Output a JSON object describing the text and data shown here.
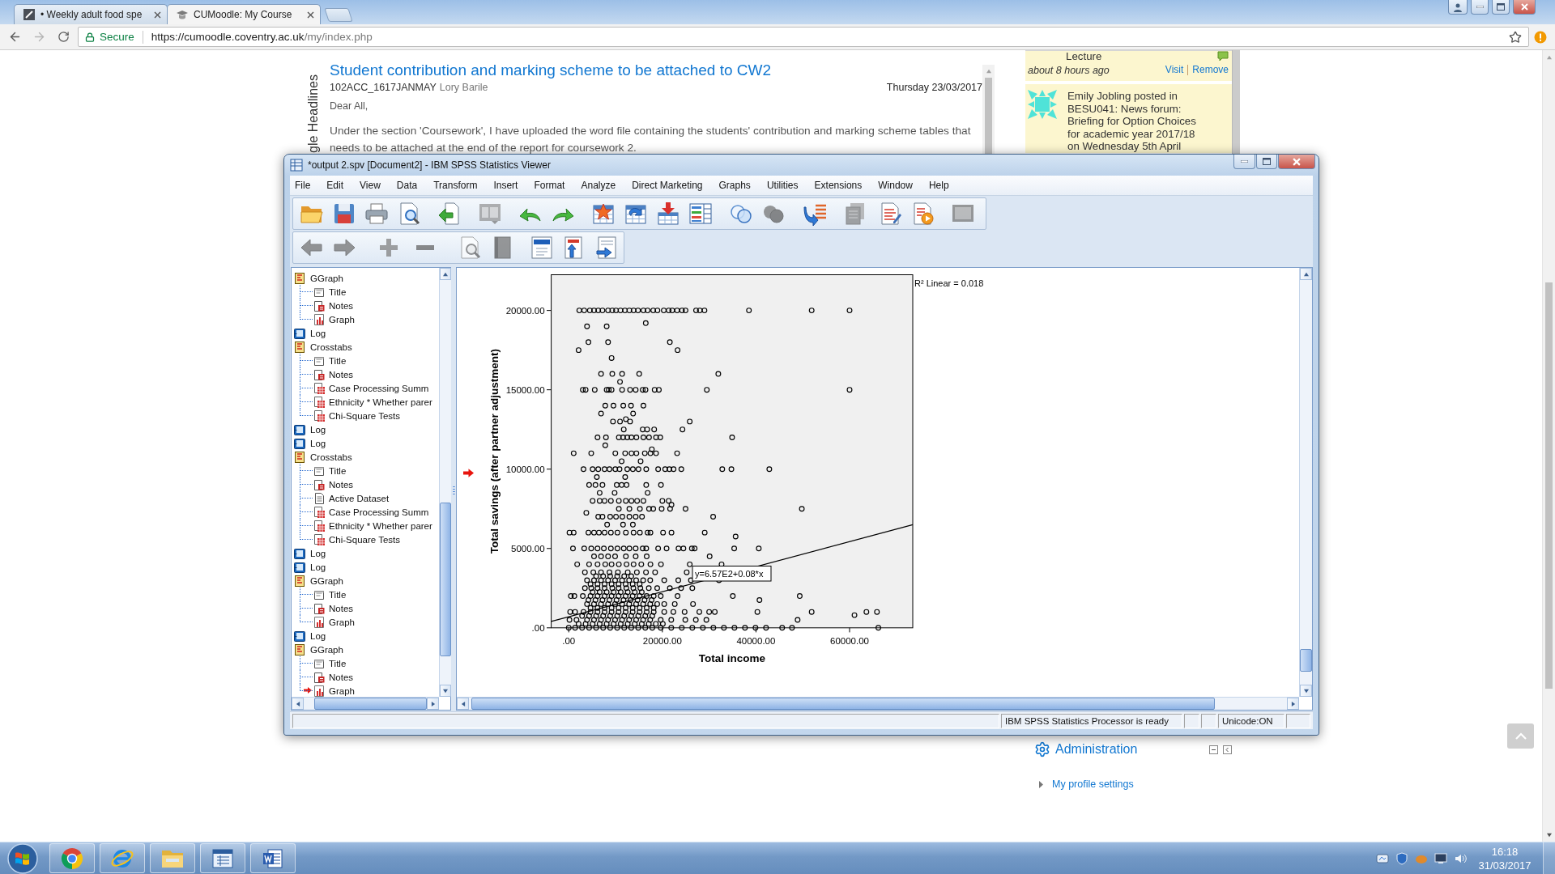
{
  "browser": {
    "tabs": [
      {
        "title": "• Weekly adult food spe",
        "selected": false
      },
      {
        "title": "CUMoodle: My Course",
        "selected": true
      }
    ],
    "back": {
      "disabled": false
    },
    "forward": {
      "disabled": true
    },
    "address": {
      "security": "Secure",
      "url_host": "https://cumoodle.coventry.ac.uk",
      "url_path": "/my/index.php"
    }
  },
  "page": {
    "block_label": "gle Headlines",
    "news": {
      "title": "Student contribution and marking scheme to be attached to CW2",
      "course": "102ACC_1617JANMAY",
      "author": "Lory Barile",
      "date": "Thursday 23/03/2017",
      "greeting": "Dear All,",
      "body": "Under the section 'Coursework', I have uploaded the word file containing the students' contribution and marking scheme tables that needs to be attached at the end of the report for coursework 2."
    },
    "activity": [
      {
        "kind": "update",
        "text": "Lecture",
        "time": "about 8 hours ago",
        "links": [
          "Visit",
          "Remove"
        ]
      },
      {
        "kind": "post",
        "text": "Emily Jobling posted in BESU041: News forum: Briefing for Option Choices for academic year 2017/18 on Wednesday 5th April"
      }
    ],
    "administration": {
      "title": "Administration",
      "items": [
        {
          "label": "My profile settings",
          "expanded": false
        }
      ]
    }
  },
  "spss": {
    "title": "*output 2.spv [Document2] - IBM SPSS Statistics Viewer",
    "menu": [
      "File",
      "Edit",
      "View",
      "Data",
      "Transform",
      "Insert",
      "Format",
      "Analyze",
      "Direct Marketing",
      "Graphs",
      "Utilities",
      "Extensions",
      "Window",
      "Help"
    ],
    "toolbar_1": [
      {
        "kind": "folder",
        "disabled": false
      },
      {
        "kind": "floppy",
        "disabled": false
      },
      {
        "kind": "printer",
        "disabled": false
      },
      {
        "kind": "doc-magnifier",
        "disabled": false
      },
      {
        "kind": "doc-arrow",
        "disabled": false
      },
      {
        "kind": "dialog",
        "disabled": true
      },
      {
        "kind": "undo",
        "disabled": false
      },
      {
        "kind": "redo",
        "disabled": false
      },
      {
        "kind": "table-star",
        "disabled": false
      },
      {
        "kind": "table-arrow",
        "disabled": false
      },
      {
        "kind": "table-down",
        "disabled": false
      },
      {
        "kind": "table-list",
        "disabled": false
      },
      {
        "kind": "circles-outline",
        "disabled": false
      },
      {
        "kind": "circles-filled",
        "disabled": true
      },
      {
        "kind": "arrow-list",
        "disabled": false
      },
      {
        "kind": "stack",
        "disabled": true
      },
      {
        "kind": "doc-lines",
        "disabled": false
      },
      {
        "kind": "doc-play",
        "disabled": false
      },
      {
        "kind": "monitor",
        "disabled": true
      }
    ],
    "toolbar_2": [
      {
        "kind": "arrow-left",
        "disabled": true
      },
      {
        "kind": "arrow-right",
        "disabled": true
      },
      {
        "kind": "plus",
        "disabled": true
      },
      {
        "kind": "minus",
        "disabled": true
      },
      {
        "kind": "doc-magnifier",
        "disabled": true
      },
      {
        "kind": "book",
        "disabled": true
      },
      {
        "kind": "doc-header",
        "disabled": false
      },
      {
        "kind": "doc-title",
        "disabled": false
      },
      {
        "kind": "doc-insert",
        "disabled": false
      }
    ],
    "outline": [
      {
        "label": "GGraph",
        "kind": "procedure",
        "current": false,
        "children": [
          {
            "label": "Title",
            "kind": "title",
            "current": false
          },
          {
            "label": "Notes",
            "kind": "notes",
            "current": false
          },
          {
            "label": "Graph",
            "kind": "chart",
            "current": false
          }
        ]
      },
      {
        "label": "Log",
        "kind": "log",
        "current": false
      },
      {
        "label": "Crosstabs",
        "kind": "procedure",
        "current": false,
        "children": [
          {
            "label": "Title",
            "kind": "title",
            "current": false
          },
          {
            "label": "Notes",
            "kind": "notes",
            "current": false
          },
          {
            "label": "Case Processing Summ",
            "kind": "table",
            "current": false
          },
          {
            "label": "Ethnicity * Whether parer",
            "kind": "table",
            "current": false
          },
          {
            "label": "Chi-Square Tests",
            "kind": "table",
            "current": false
          }
        ]
      },
      {
        "label": "Log",
        "kind": "log",
        "current": false
      },
      {
        "label": "Log",
        "kind": "log",
        "current": false
      },
      {
        "label": "Crosstabs",
        "kind": "procedure",
        "current": false,
        "children": [
          {
            "label": "Title",
            "kind": "title",
            "current": false
          },
          {
            "label": "Notes",
            "kind": "notes",
            "current": false
          },
          {
            "label": "Active Dataset",
            "kind": "text",
            "current": false
          },
          {
            "label": "Case Processing Summ",
            "kind": "table",
            "current": false
          },
          {
            "label": "Ethnicity * Whether parer",
            "kind": "table",
            "current": false
          },
          {
            "label": "Chi-Square Tests",
            "kind": "table",
            "current": false
          }
        ]
      },
      {
        "label": "Log",
        "kind": "log",
        "current": false
      },
      {
        "label": "Log",
        "kind": "log",
        "current": false
      },
      {
        "label": "GGraph",
        "kind": "procedure",
        "current": false,
        "children": [
          {
            "label": "Title",
            "kind": "title",
            "current": false
          },
          {
            "label": "Notes",
            "kind": "notes",
            "current": false
          },
          {
            "label": "Graph",
            "kind": "chart",
            "current": false
          }
        ]
      },
      {
        "label": "Log",
        "kind": "log",
        "current": false
      },
      {
        "label": "GGraph",
        "kind": "procedure",
        "current": false,
        "children": [
          {
            "label": "Title",
            "kind": "title",
            "current": false
          },
          {
            "label": "Notes",
            "kind": "notes",
            "current": false
          },
          {
            "label": "Graph",
            "kind": "chart",
            "current": true
          }
        ]
      }
    ],
    "viewer": {
      "current": true,
      "chart_data": {
        "type": "scatter",
        "xlabel": "Total income",
        "ylabel": "Total savings (after partner adjustment)",
        "xlim": [
          -3750,
          73500
        ],
        "ylim": [
          0,
          22250
        ],
        "xticks": [
          {
            "value": 0,
            "label": ".00"
          },
          {
            "value": 20000,
            "label": "20000.00"
          },
          {
            "value": 40000,
            "label": "40000.00"
          },
          {
            "value": 60000,
            "label": "60000.00"
          }
        ],
        "yticks": [
          {
            "value": 0,
            "label": ".00"
          },
          {
            "value": 5000,
            "label": "5000.00"
          },
          {
            "value": 10000,
            "label": "10000.00"
          },
          {
            "value": 15000,
            "label": "15000.00"
          },
          {
            "value": 20000,
            "label": "20000.00"
          }
        ],
        "series": [
          {
            "type": "scatter",
            "x": [
              2250,
              3300,
              4500,
              5400,
              6300,
              7200,
              8400,
              9300,
              10100,
              11050,
              12000,
              12950,
              13850,
              14800,
              15950,
              16850,
              18050,
              18950,
              20300,
              21350,
              22100,
              23150,
              24200,
              24950,
              27200,
              28000,
              29000,
              38500,
              51900,
              60000,
              16450,
              3900,
              8100,
              4200,
              8400,
              21600,
              2100,
              23250,
              9150,
              6900,
              9300,
              11400,
              15050,
              31950,
              10950,
              3000,
              3600,
              5550,
              8100,
              8550,
              9150,
              11400,
              13100,
              14300,
              15800,
              16400,
              18350,
              19250,
              29500,
              60000,
              7800,
              9550,
              11650,
              13300,
              15950,
              6900,
              13750,
              9450,
              10950,
              13100,
              25850,
              12200,
              11750,
              15800,
              16750,
              18250,
              24300,
              6150,
              7950,
              10700,
              11600,
              12500,
              13400,
              14450,
              15950,
              17150,
              18650,
              19550,
              34900,
              7800,
              1050,
              4800,
              9950,
              12050,
              13400,
              14450,
              16250,
              17450,
              18650,
              23150,
              17750,
              11300,
              15350,
              3150,
              5100,
              6300,
              7650,
              8700,
              9950,
              10850,
              12500,
              13700,
              14900,
              16550,
              19100,
              20600,
              21500,
              22400,
              24050,
              32800,
              34750,
              42850,
              6000,
              12050,
              4350,
              5700,
              7200,
              10250,
              11300,
              12350,
              16550,
              19700,
              6600,
              9800,
              16850,
              5100,
              6600,
              7650,
              9000,
              10700,
              12200,
              13400,
              14600,
              15950,
              20000,
              21350,
              21950,
              3750,
              10700,
              12950,
              15200,
              17150,
              18050,
              19850,
              21650,
              24950,
              49800,
              6300,
              7200,
              8850,
              10100,
              11450,
              12950,
              14300,
              15650,
              30850,
              8200,
              11600,
              13700,
              150,
              1050,
              4200,
              5400,
              6450,
              7650,
              9000,
              10400,
              12200,
              13850,
              15200,
              16850,
              17450,
              20150,
              21950,
              29050,
              35650,
              900,
              3300,
              4800,
              6150,
              7500,
              9000,
              10400,
              11750,
              12950,
              14300,
              15800,
              16550,
              19100,
              20900,
              23450,
              24500,
              26300,
              26900,
              35350,
              40600,
              5400,
              6900,
              8400,
              9900,
              12200,
              14300,
              16650,
              30100,
              1800,
              4350,
              6150,
              7800,
              9150,
              10700,
              12350,
              13850,
              15500,
              17450,
              19700,
              25850,
              32650,
              3450,
              5250,
              6900,
              8700,
              10500,
              12600,
              14550,
              16500,
              18450,
              25200,
              5850,
              7350,
              8850,
              10350,
              11850,
              13350,
              3900,
              5400,
              6900,
              8400,
              9900,
              11400,
              12900,
              14400,
              15900,
              17400,
              20400,
              23400,
              26100,
              32100,
              4650,
              6150,
              7650,
              9150,
              10650,
              12150,
              13650,
              15150,
              3450,
              4800,
              6150,
              7650,
              9300,
              10650,
              12300,
              13800,
              15300,
              17100,
              18900,
              21600,
              24000,
              26400,
              5100,
              6600,
              8100,
              9600,
              11100,
              12600,
              14100,
              15600,
              450,
              1200,
              3000,
              4650,
              6150,
              7650,
              9150,
              10650,
              12150,
              13650,
              15150,
              16650,
              18150,
              19650,
              23250,
              35050,
              49350,
              40750,
              4200,
              5700,
              7200,
              8700,
              10200,
              11700,
              13200,
              14700,
              16200,
              17700,
              3900,
              5400,
              6900,
              8400,
              9900,
              11400,
              12900,
              14400,
              15900,
              17400,
              18900,
              20400,
              22650,
              26550,
              4650,
              6150,
              7650,
              9150,
              10650,
              12150,
              13650,
              15150,
              16650,
              18150,
              300,
              1350,
              3150,
              4650,
              6150,
              7650,
              9150,
              10650,
              12150,
              13650,
              15150,
              16650,
              18150,
              20400,
              22350,
              24750,
              27900,
              30000,
              31200,
              40300,
              51900,
              63600,
              65850,
              61050,
              2850,
              4350,
              5850,
              7350,
              8850,
              10350,
              11850,
              13350,
              14850,
              16350,
              17850,
              150,
              1650,
              3900,
              5400,
              6900,
              8400,
              9900,
              11400,
              12900,
              14400,
              15900,
              17400,
              19650,
              21900,
              24900,
              27150,
              29400,
              48900,
              2100,
              3600,
              5100,
              6600,
              8100,
              9600,
              11100,
              12600,
              14100,
              15600,
              17100,
              18600,
              20100,
              0,
              1350,
              2850,
              4350,
              5850,
              7350,
              8850,
              10350,
              11850,
              13350,
              14850,
              16350,
              17850,
              19650,
              21900,
              24150,
              26400,
              28650,
              30900,
              33150,
              35400,
              37650,
              39900,
              42150,
              45600,
              47700,
              66150
            ],
            "values": [
              20000,
              20000,
              20000,
              20000,
              20000,
              20000,
              20000,
              20000,
              20000,
              20000,
              20000,
              20000,
              20000,
              20000,
              20000,
              20000,
              20000,
              20000,
              20000,
              20000,
              20000,
              20000,
              20000,
              20000,
              20000,
              20000,
              20000,
              20000,
              20000,
              20000,
              19200,
              19000,
              19000,
              18000,
              18000,
              18000,
              17500,
              17500,
              17000,
              16000,
              16000,
              16000,
              16000,
              16000,
              15500,
              15000,
              15000,
              15000,
              15000,
              15000,
              15000,
              15000,
              15000,
              15000,
              15000,
              15000,
              15000,
              15000,
              15000,
              15000,
              14000,
              14000,
              14000,
              14000,
              14000,
              13500,
              13500,
              13000,
              13000,
              13000,
              13000,
              13150,
              12500,
              12500,
              12500,
              12500,
              12500,
              12000,
              12000,
              12000,
              12000,
              12000,
              12000,
              12000,
              12000,
              12000,
              12000,
              12000,
              12000,
              11500,
              11000,
              11000,
              11000,
              11000,
              11000,
              11000,
              11000,
              11000,
              11000,
              11000,
              11250,
              10500,
              10500,
              10000,
              10000,
              10000,
              10000,
              10000,
              10000,
              10000,
              10000,
              10000,
              10000,
              10000,
              10000,
              10000,
              10000,
              10000,
              10000,
              10000,
              10000,
              10000,
              9500,
              9500,
              9000,
              9000,
              9000,
              9000,
              9000,
              9000,
              9000,
              9000,
              8500,
              8500,
              8500,
              8000,
              8000,
              8000,
              8000,
              8000,
              8000,
              8000,
              8000,
              8000,
              8000,
              8000,
              7750,
              7250,
              7500,
              7500,
              7500,
              7500,
              7500,
              7500,
              7500,
              7500,
              7500,
              7000,
              7000,
              7000,
              7000,
              7000,
              7000,
              7000,
              7000,
              7000,
              6500,
              6500,
              6500,
              6000,
              6000,
              6000,
              6000,
              6000,
              6000,
              6000,
              6000,
              6000,
              6000,
              6000,
              6000,
              6000,
              6000,
              6000,
              6000,
              5750,
              5000,
              5000,
              5000,
              5000,
              5000,
              5000,
              5000,
              5000,
              5000,
              5000,
              5000,
              5000,
              5000,
              5000,
              5000,
              5000,
              5000,
              5000,
              5000,
              5000,
              4500,
              4500,
              4500,
              4500,
              4500,
              4500,
              4500,
              4500,
              4000,
              4000,
              4000,
              4000,
              4000,
              4000,
              4000,
              4000,
              4000,
              4000,
              4000,
              4000,
              4000,
              3500,
              3500,
              3500,
              3500,
              3500,
              3500,
              3500,
              3500,
              3500,
              3500,
              3250,
              3250,
              3250,
              3250,
              3250,
              3250,
              3000,
              3000,
              3000,
              3000,
              3000,
              3000,
              3000,
              3000,
              3000,
              3000,
              3000,
              3000,
              3000,
              3000,
              2750,
              2750,
              2750,
              2750,
              2750,
              2750,
              2750,
              2750,
              2500,
              2500,
              2500,
              2500,
              2500,
              2500,
              2500,
              2500,
              2500,
              2500,
              2500,
              2500,
              2500,
              2500,
              2250,
              2250,
              2250,
              2250,
              2250,
              2250,
              2250,
              2250,
              2000,
              2000,
              2000,
              2000,
              2000,
              2000,
              2000,
              2000,
              2000,
              2000,
              2000,
              2000,
              2000,
              2000,
              2000,
              2000,
              2000,
              1750,
              1750,
              1750,
              1750,
              1750,
              1750,
              1750,
              1750,
              1750,
              1750,
              1750,
              1500,
              1500,
              1500,
              1500,
              1500,
              1500,
              1500,
              1500,
              1500,
              1500,
              1500,
              1500,
              1500,
              1500,
              1250,
              1250,
              1250,
              1250,
              1250,
              1250,
              1250,
              1250,
              1250,
              1250,
              1000,
              1000,
              1000,
              1000,
              1000,
              1000,
              1000,
              1000,
              1000,
              1000,
              1000,
              1000,
              1000,
              1000,
              1000,
              1000,
              1000,
              1000,
              1000,
              1000,
              1000,
              1000,
              1000,
              800,
              750,
              750,
              750,
              750,
              750,
              750,
              750,
              750,
              750,
              750,
              750,
              500,
              500,
              500,
              500,
              500,
              500,
              500,
              500,
              500,
              500,
              500,
              500,
              500,
              500,
              500,
              500,
              500,
              500,
              250,
              250,
              250,
              250,
              250,
              250,
              250,
              250,
              250,
              250,
              250,
              250,
              250,
              0,
              0,
              0,
              0,
              0,
              0,
              0,
              0,
              0,
              0,
              0,
              0,
              0,
              0,
              0,
              0,
              0,
              0,
              0,
              0,
              0,
              0,
              0,
              0,
              0,
              0,
              0
            ]
          },
          {
            "type": "line",
            "x": [
              -3750,
              73500
            ],
            "values": [
              400,
              6500
            ]
          }
        ],
        "annotations": [
          "R² Linear = 0.018",
          "y=6.57E2+0.08*x"
        ]
      }
    },
    "status_bar": [
      "IBM SPSS Statistics Processor is ready",
      "Unicode:ON"
    ]
  },
  "taskbar": {
    "time": "16:18",
    "date": "31/03/2017"
  }
}
